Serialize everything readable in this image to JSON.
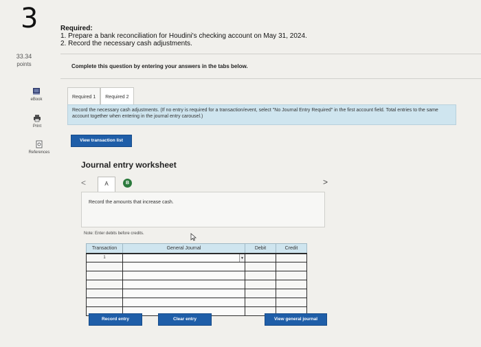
{
  "question": {
    "number": "3",
    "points_value": "33.34",
    "points_label": "points"
  },
  "side_tools": [
    {
      "label": "eBook",
      "icon": "book-icon"
    },
    {
      "label": "Print",
      "icon": "printer-icon"
    },
    {
      "label": "References",
      "icon": "references-icon"
    }
  ],
  "required": {
    "heading": "Required:",
    "items": [
      "1. Prepare a bank reconciliation for Houdini's checking account on May 31, 2024.",
      "2. Record the necessary cash adjustments."
    ]
  },
  "instruction": "Complete this question by entering your answers in the tabs below.",
  "tabs": [
    {
      "label": "Required 1",
      "active": false
    },
    {
      "label": "Required 2",
      "active": true
    }
  ],
  "info_text": "Record the necessary cash adjustments. (If no entry is required for a transaction/event, select \"No Journal Entry Required\" in the first account field. Total entries to the same account together when entering in the journal entry carousel.)",
  "view_transaction_list_label": "View transaction list",
  "worksheet": {
    "title": "Journal entry worksheet",
    "nav_prev": "<",
    "nav_next": ">",
    "step_a": "A",
    "step_b": "B",
    "record_prompt": "Record the amounts that increase cash.",
    "note": "Note: Enter debits before credits.",
    "columns": [
      "Transaction",
      "General Journal",
      "Debit",
      "Credit"
    ],
    "rows": [
      {
        "transaction": "1",
        "general_journal": "",
        "debit": "",
        "credit": ""
      },
      {
        "transaction": "",
        "general_journal": "",
        "debit": "",
        "credit": ""
      },
      {
        "transaction": "",
        "general_journal": "",
        "debit": "",
        "credit": ""
      },
      {
        "transaction": "",
        "general_journal": "",
        "debit": "",
        "credit": ""
      },
      {
        "transaction": "",
        "general_journal": "",
        "debit": "",
        "credit": ""
      },
      {
        "transaction": "",
        "general_journal": "",
        "debit": "",
        "credit": ""
      },
      {
        "transaction": "",
        "general_journal": "",
        "debit": "",
        "credit": ""
      }
    ],
    "buttons": {
      "record_entry": "Record entry",
      "clear_entry": "Clear entry",
      "view_general_journal": "View general journal"
    }
  },
  "colors": {
    "accent_blue": "#1f5ea8",
    "info_bg": "#cfe5ef",
    "step_green": "#2c7a3d"
  }
}
